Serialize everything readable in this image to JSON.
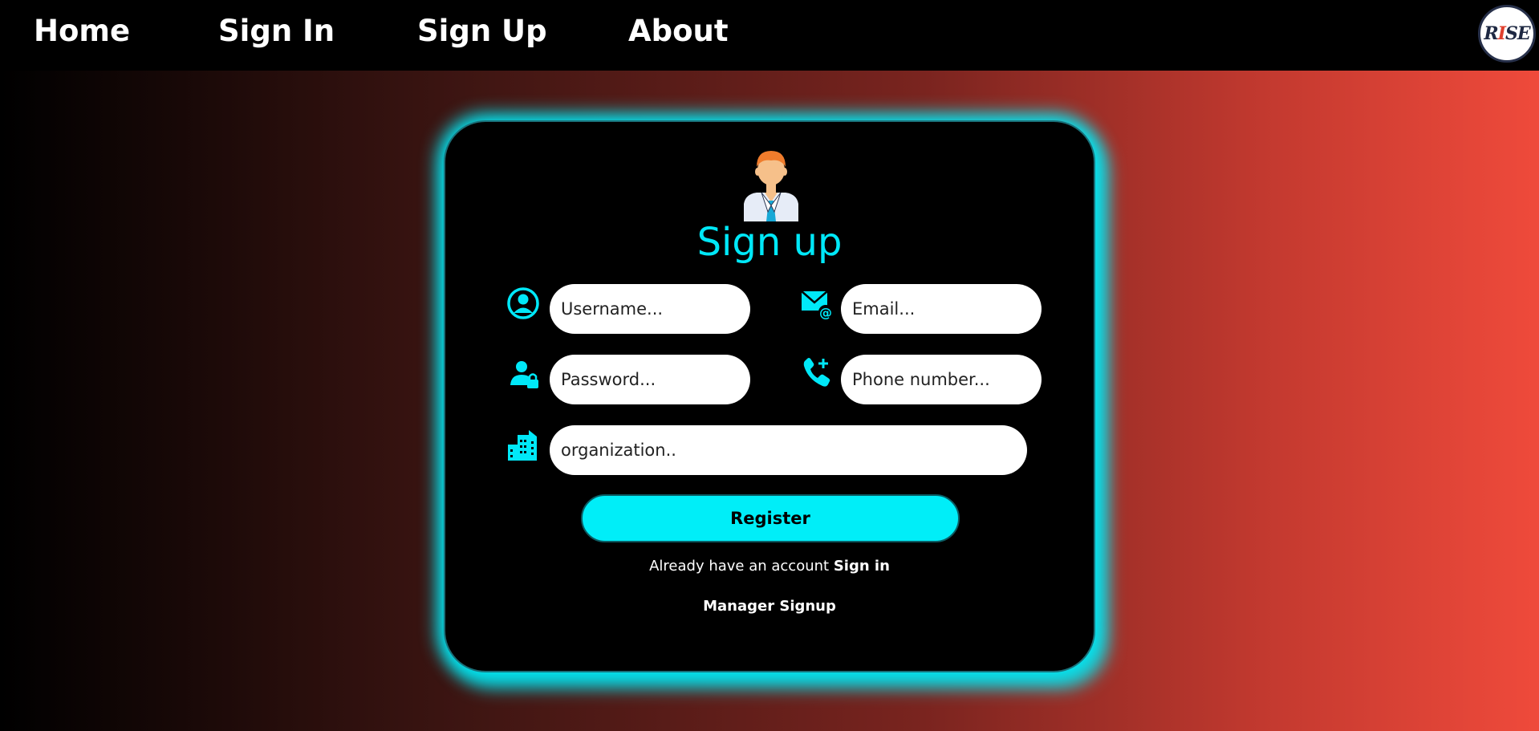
{
  "nav": {
    "items": [
      {
        "label": "Home"
      },
      {
        "label": "Sign In"
      },
      {
        "label": "Sign Up"
      },
      {
        "label": "About"
      }
    ],
    "logo": {
      "text_pre": "R",
      "text_accent": "I",
      "text_post": "SE"
    }
  },
  "card": {
    "title": "Sign up",
    "fields": {
      "username": {
        "placeholder": "Username...",
        "value": ""
      },
      "email": {
        "placeholder": "Email...",
        "value": ""
      },
      "password": {
        "placeholder": "Password...",
        "value": ""
      },
      "phone": {
        "placeholder": "Phone number...",
        "value": ""
      },
      "organization": {
        "placeholder": "organization..",
        "value": ""
      }
    },
    "register_label": "Register",
    "already_text": "Already have an account",
    "signin_link": "Sign in",
    "manager_link": "Manager Signup"
  },
  "colors": {
    "accent": "#00e8f8",
    "card_bg": "#000000",
    "gradient_start": "#000000",
    "gradient_end": "#ef4a3b"
  },
  "icons": [
    "user-circle-icon",
    "email-at-icon",
    "user-lock-icon",
    "phone-plus-icon",
    "building-icon",
    "avatar-icon"
  ]
}
